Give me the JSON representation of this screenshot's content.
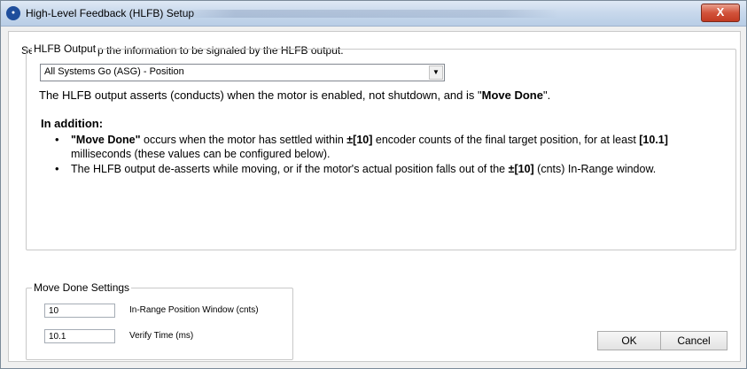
{
  "window": {
    "title": "High-Level Feedback (HLFB) Setup",
    "close_label": "X"
  },
  "intro": "Select and set up the information to be signaled by the HLFB output.",
  "hlfb_output": {
    "group_label": "HLFB Output",
    "selected_option": "All Systems Go (ASG) - Position",
    "description_prefix": "The HLFB output asserts (conducts) when the motor is enabled, not shutdown, and is \"",
    "description_bold": "Move Done",
    "description_suffix": "\".",
    "addition_heading": "In addition:",
    "bullet1_bold": "\"Move Done\"",
    "bullet1_a": " occurs when the motor has settled within ",
    "bullet1_window": "±[10]",
    "bullet1_b": " encoder counts of the final target position, for at least ",
    "bullet1_time": "[10.1]",
    "bullet1_c": " milliseconds (these values can be configured below).",
    "bullet2_a": "The HLFB output de-asserts while moving, or if the motor's actual position falls out of the ",
    "bullet2_window": "±[10]",
    "bullet2_b": " (cnts) In-Range window."
  },
  "move_done": {
    "group_label": "Move Done Settings",
    "position_window_value": "10",
    "position_window_label": "In-Range Position Window (cnts)",
    "verify_time_value": "10.1",
    "verify_time_label": "Verify Time (ms)"
  },
  "buttons": {
    "ok": "OK",
    "cancel": "Cancel"
  }
}
